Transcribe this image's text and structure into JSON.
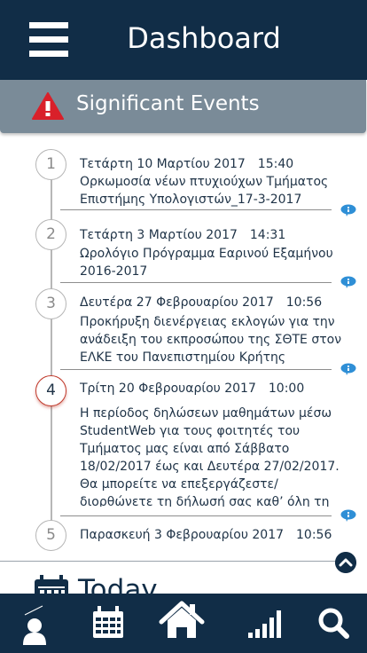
{
  "header": {
    "title": "Dashboard",
    "menu_icon": "hamburger-menu-icon"
  },
  "significant_events": {
    "title": "Significant Events",
    "icon": "warning-icon",
    "accent_color": "#d9202a"
  },
  "events": [
    {
      "number": "1",
      "date": "Τετάρτη 10 Μαρτίου 2017",
      "time": "15:40",
      "text": "Ορκωμοσία νέων πτυχιούχων Τμήματος Επιστήμης Υπολογιστών_17-3-2017",
      "active": false
    },
    {
      "number": "2",
      "date": "Τετάρτη 3 Μαρτίου 2017",
      "time": "14:31",
      "text": "Ωρολόγιο Πρόγραμμα Εαρινού Εξαμήνου 2016-2017",
      "active": false
    },
    {
      "number": "3",
      "date": "Δευτέρα 27 Φεβρουαρίου 2017",
      "time": "10:56",
      "text": "Προκήρυξη διενέργειας εκλογών για την ανάδειξη του εκπροσώπου της ΣΘΤΕ στον ΕΛΚΕ του Πανεπιστημίου Κρήτης",
      "active": false
    },
    {
      "number": "4",
      "date": "Τρίτη  20 Φεβρουαρίου 2017",
      "time": "10:00",
      "text": "Η περίοδος δηλώσεων μαθημάτων μέσω StudentWeb για τους φοιτητές του Τμήματος μας είναι από Σάββατο 18/02/2017 έως και Δευτέρα 27/02/2017. Θα μπορείτε να επεξεργάζεστε/ διορθώνετε τη δήλωσή σας καθ’ όλη τη",
      "active": true
    },
    {
      "number": "5",
      "date": "Παρασκευή 3 Φεβρουαρίου 2017",
      "time": "10:56",
      "text": "",
      "active": false
    }
  ],
  "today": {
    "label": "Today",
    "icon": "calendar-icon"
  },
  "bottom_nav": [
    {
      "name": "profile",
      "icon": "user-icon"
    },
    {
      "name": "calendar",
      "icon": "calendar-icon"
    },
    {
      "name": "home",
      "icon": "home-icon"
    },
    {
      "name": "stats",
      "icon": "signal-bars-icon"
    },
    {
      "name": "search",
      "icon": "search-icon"
    }
  ],
  "colors": {
    "primary": "#112d47",
    "banner": "#7a8b98",
    "bubble": "#2f8fd6",
    "warning": "#d9202a"
  }
}
